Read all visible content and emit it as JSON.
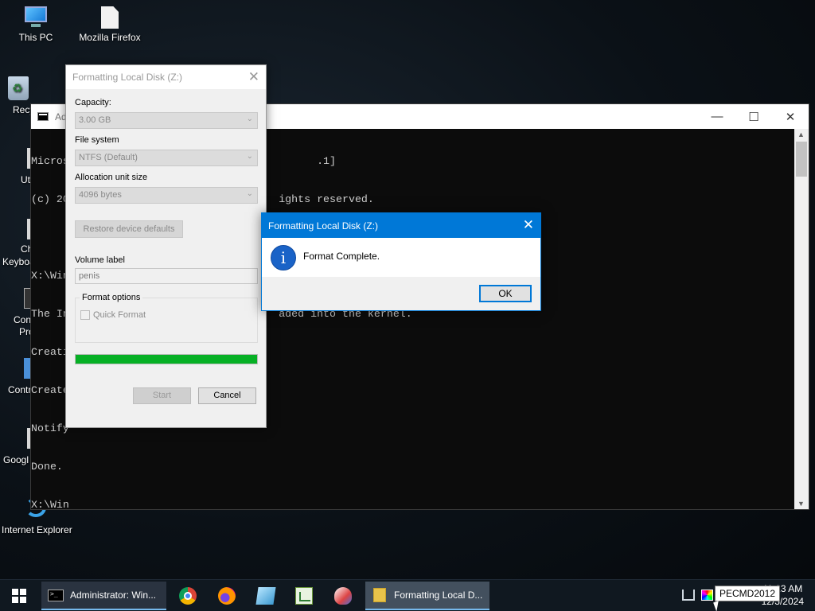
{
  "desktop": {
    "icons": [
      {
        "label": "This PC",
        "icon": "computer-icon"
      },
      {
        "label": "Mozilla Firefox",
        "icon": "file-icon"
      },
      {
        "label": "Recy",
        "icon": "recycle-bin-icon"
      },
      {
        "label": "Ut",
        "icon": "app-icon"
      },
      {
        "label": "Ch",
        "icon": "app-icon"
      },
      {
        "label": "Keyboa",
        "icon": "app-icon"
      },
      {
        "label": "Con",
        "icon": "app-icon"
      },
      {
        "label": "Pro",
        "icon": "app-icon"
      },
      {
        "label": "Contr",
        "icon": "app-icon"
      },
      {
        "label": "Googl",
        "icon": "app-icon"
      },
      {
        "label": "Internet Explorer",
        "icon": "internet-explorer-icon"
      }
    ]
  },
  "console": {
    "title": "Ad",
    "lines": [
      "Micros                                       .1]",
      "(c) 20                                 ights reserved.",
      "",
      "X:\\Win                                s 3G -m Z:",
      "The In                                 aded into the kernel.",
      "Creati",
      "Create",
      "Notify",
      "Done.",
      "X:\\Win"
    ],
    "controls": {
      "minimize": "—",
      "maximize": "☐",
      "close": "✕"
    }
  },
  "format_dialog": {
    "title": "Formatting Local Disk (Z:)",
    "capacity_label": "Capacity:",
    "capacity_value": "3.00 GB",
    "filesystem_label": "File system",
    "filesystem_value": "NTFS (Default)",
    "allocation_label": "Allocation unit size",
    "allocation_value": "4096 bytes",
    "restore_button": "Restore device defaults",
    "volume_label_label": "Volume label",
    "volume_label_value": "penis",
    "format_options_label": "Format options",
    "quick_format_label": "Quick Format",
    "progress_percent": 100,
    "start_button": "Start",
    "cancel_button": "Cancel"
  },
  "message_box": {
    "title": "Formatting Local Disk (Z:)",
    "message": "Format Complete.",
    "info_glyph": "i",
    "ok_button": "OK"
  },
  "taskbar": {
    "items": [
      {
        "label": "Administrator: Win...",
        "icon": "command-prompt-icon"
      },
      {
        "label": "Formatting Local D...",
        "icon": "folder-icon"
      }
    ],
    "pinned": [
      "chrome-icon",
      "firefox-icon",
      "notepad-icon",
      "chart-app-icon",
      "paint-app-icon"
    ],
    "tooltip": "PECMD2012",
    "clock_time": "11:13 AM",
    "clock_date": "12/3/2024"
  },
  "colors": {
    "accent": "#0078d7",
    "progress": "#06b025",
    "console_bg": "#0c0c0c"
  }
}
